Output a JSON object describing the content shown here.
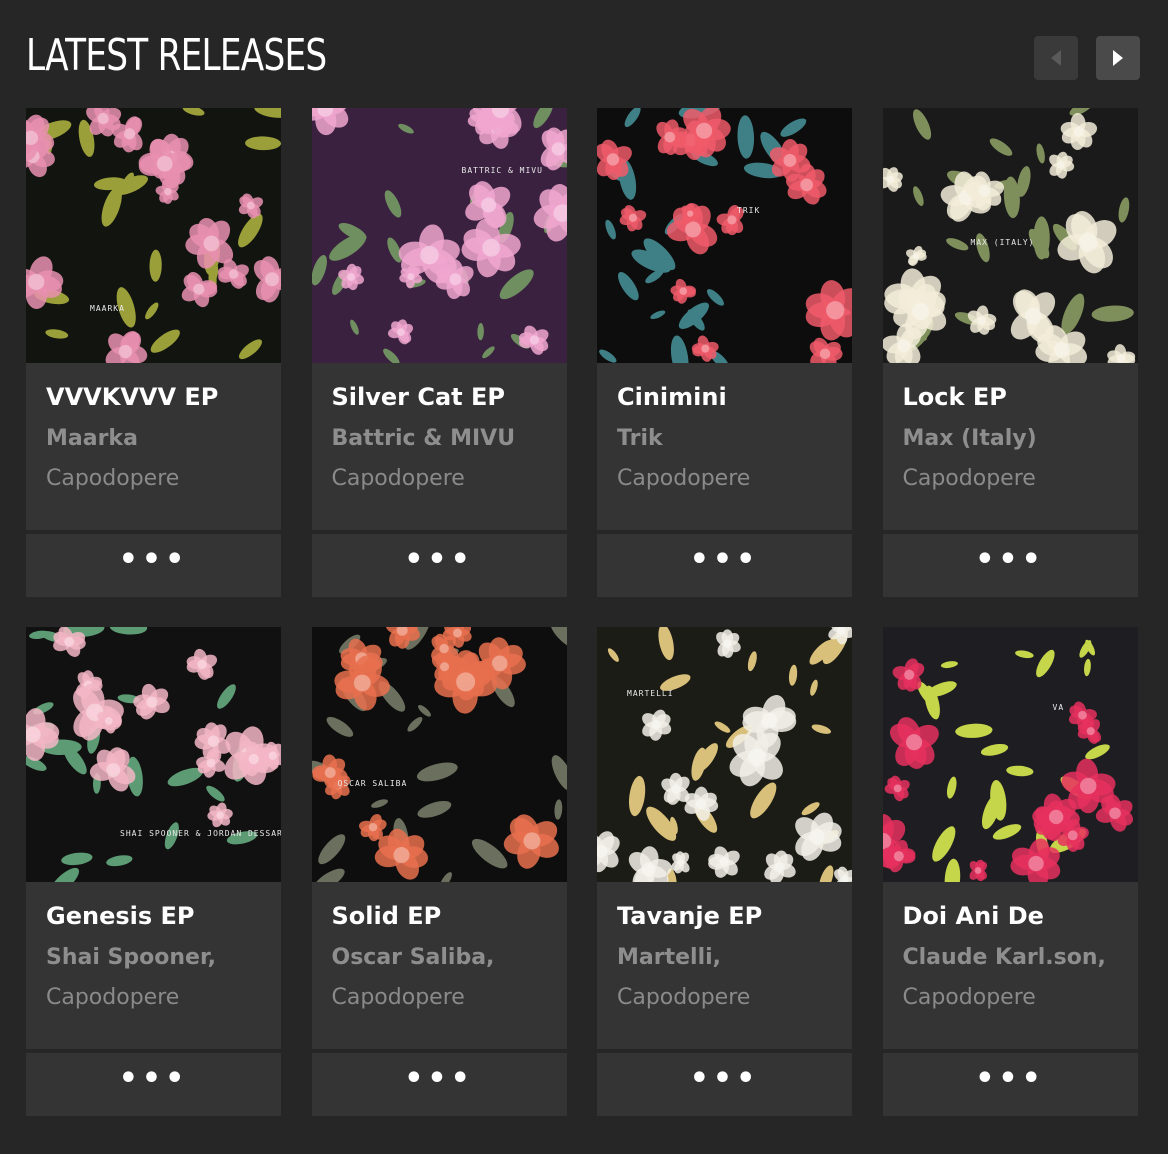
{
  "header": {
    "title": "LATEST RELEASES",
    "prev_icon": "chevron-left-icon",
    "next_icon": "chevron-right-icon"
  },
  "colors": {
    "background": "#262626",
    "card": "#343434",
    "title": "#ffffff",
    "muted": "#8e8e8e"
  },
  "releases": [
    {
      "title": "VVVKVVV EP",
      "artist": "Maarka",
      "label": "Capodopere",
      "art_caption": "MAARKA",
      "art_bg": "#12140f",
      "flower": "#e98fb0",
      "leaf": "#9a9f3a",
      "more": "•••",
      "more_icon": "more-icon"
    },
    {
      "title": "Silver Cat EP",
      "artist": "Battric & MIVU",
      "label": "Capodopere",
      "art_caption": "BATTRIC & MIVU",
      "art_bg": "#3a2140",
      "flower": "#f0a6cf",
      "leaf": "#6f8f60",
      "more": "•••",
      "more_icon": "more-icon"
    },
    {
      "title": "Cinimini",
      "artist": "Trik",
      "label": "Capodopere",
      "art_caption": "TRIK",
      "art_bg": "#0d0d0d",
      "flower": "#f05a6a",
      "leaf": "#3f7f86",
      "more": "•••",
      "more_icon": "more-icon"
    },
    {
      "title": "Lock EP",
      "artist": "Max (Italy)",
      "label": "Capodopere",
      "art_caption": "MAX (ITALY)",
      "art_bg": "#1a1a1a",
      "flower": "#f2ecd8",
      "leaf": "#7f8f5c",
      "more": "•••",
      "more_icon": "more-icon"
    },
    {
      "title": "Genesis EP",
      "artist": "Shai Spooner,",
      "label": "Capodopere",
      "art_caption": "SHAI SPOONER & JORDAN DESSAR",
      "art_bg": "#111111",
      "flower": "#f3b6c6",
      "leaf": "#5d9b74",
      "more": "•••",
      "more_icon": "more-icon"
    },
    {
      "title": "Solid EP",
      "artist": "Oscar Saliba,",
      "label": "Capodopere",
      "art_caption": "OSCAR SALIBA",
      "art_bg": "#0e0e0e",
      "flower": "#e7704e",
      "leaf": "#6b6f5e",
      "more": "•••",
      "more_icon": "more-icon"
    },
    {
      "title": "Tavanje EP",
      "artist": "Martelli,",
      "label": "Capodopere",
      "art_caption": "MARTELLI",
      "art_bg": "#1b1c16",
      "flower": "#f1efe6",
      "leaf": "#d9c07a",
      "more": "•••",
      "more_icon": "more-icon"
    },
    {
      "title": "Doi Ani De",
      "artist": "Claude Karl.son,",
      "label": "Capodopere",
      "art_caption": "VA",
      "art_bg": "#1e1e22",
      "flower": "#e6305e",
      "leaf": "#c6d64a",
      "more": "•••",
      "more_icon": "more-icon"
    }
  ]
}
